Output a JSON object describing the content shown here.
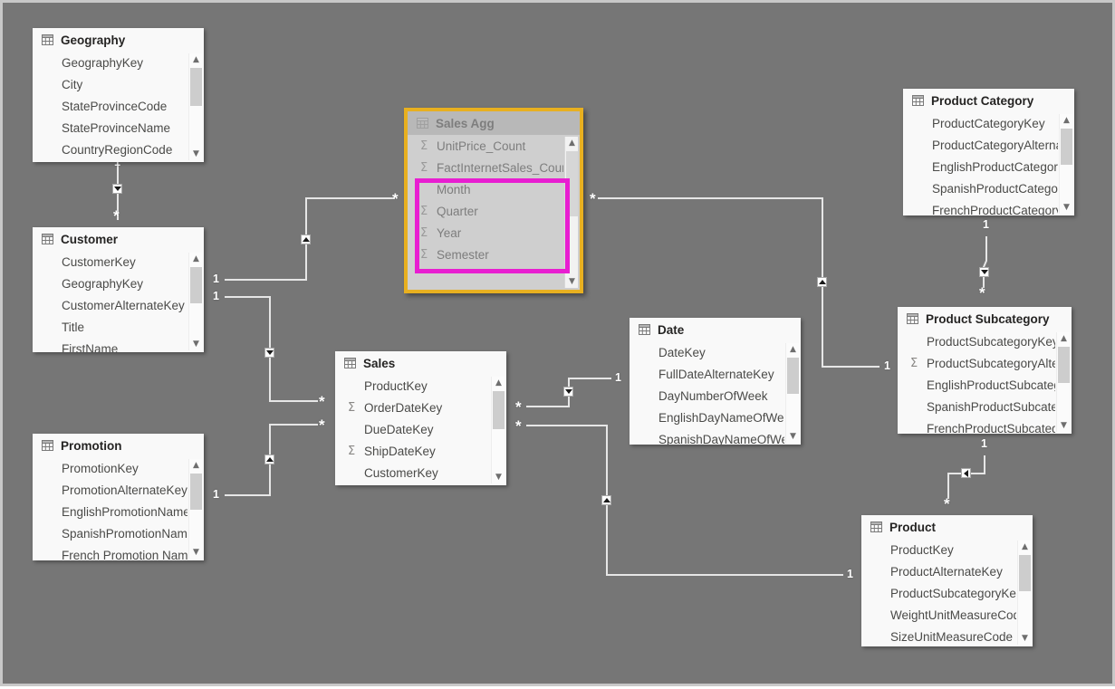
{
  "canvas": {
    "background_color": "#767676",
    "border_color": "#c8c8c8"
  },
  "highlight": {
    "selected_table_border_color": "#e8b020",
    "emphasis_box_color": "#e81ed1",
    "emphasis_fields": [
      "Month",
      "Quarter",
      "Year",
      "Semester"
    ]
  },
  "tables": [
    {
      "id": "geography",
      "name": "Geography",
      "icon": "table-grid-icon",
      "fields": [
        {
          "name": "GeographyKey",
          "aggregate": false
        },
        {
          "name": "City",
          "aggregate": false
        },
        {
          "name": "StateProvinceCode",
          "aggregate": false
        },
        {
          "name": "StateProvinceName",
          "aggregate": false
        },
        {
          "name": "CountryRegionCode",
          "aggregate": false
        }
      ]
    },
    {
      "id": "customer",
      "name": "Customer",
      "icon": "table-grid-icon",
      "fields": [
        {
          "name": "CustomerKey",
          "aggregate": false
        },
        {
          "name": "GeographyKey",
          "aggregate": false
        },
        {
          "name": "CustomerAlternateKey",
          "aggregate": false
        },
        {
          "name": "Title",
          "aggregate": false
        },
        {
          "name": "FirstName",
          "aggregate": false
        }
      ]
    },
    {
      "id": "promotion",
      "name": "Promotion",
      "icon": "table-grid-icon",
      "fields": [
        {
          "name": "PromotionKey",
          "aggregate": false
        },
        {
          "name": "PromotionAlternateKey",
          "aggregate": false
        },
        {
          "name": "EnglishPromotionName",
          "aggregate": false
        },
        {
          "name": "SpanishPromotionName",
          "aggregate": false
        },
        {
          "name": "French Promotion Name",
          "aggregate": false
        }
      ]
    },
    {
      "id": "salesagg",
      "name": "Sales Agg",
      "icon": "table-grid-icon",
      "selected": true,
      "fields": [
        {
          "name": "UnitPrice_Count",
          "aggregate": true
        },
        {
          "name": "FactInternetSales_Count",
          "aggregate": true
        },
        {
          "name": "Month",
          "aggregate": false
        },
        {
          "name": "Quarter",
          "aggregate": true
        },
        {
          "name": "Year",
          "aggregate": true
        },
        {
          "name": "Semester",
          "aggregate": true
        }
      ]
    },
    {
      "id": "sales",
      "name": "Sales",
      "icon": "table-grid-icon",
      "fields": [
        {
          "name": "ProductKey",
          "aggregate": false
        },
        {
          "name": "OrderDateKey",
          "aggregate": true
        },
        {
          "name": "DueDateKey",
          "aggregate": false
        },
        {
          "name": "ShipDateKey",
          "aggregate": true
        },
        {
          "name": "CustomerKey",
          "aggregate": false
        }
      ]
    },
    {
      "id": "date",
      "name": "Date",
      "icon": "table-grid-icon",
      "fields": [
        {
          "name": "DateKey",
          "aggregate": false
        },
        {
          "name": "FullDateAlternateKey",
          "aggregate": false
        },
        {
          "name": "DayNumberOfWeek",
          "aggregate": false
        },
        {
          "name": "EnglishDayNameOfWeek",
          "aggregate": false
        },
        {
          "name": "SpanishDayNameOfWeek",
          "aggregate": false
        }
      ]
    },
    {
      "id": "productcategory",
      "name": "Product Category",
      "icon": "table-grid-icon",
      "fields": [
        {
          "name": "ProductCategoryKey",
          "aggregate": false
        },
        {
          "name": "ProductCategoryAlternateKey",
          "aggregate": false
        },
        {
          "name": "EnglishProductCategoryName",
          "aggregate": false
        },
        {
          "name": "SpanishProductCategoryName",
          "aggregate": false
        },
        {
          "name": "FrenchProductCategoryName",
          "aggregate": false
        }
      ]
    },
    {
      "id": "productsubcategory",
      "name": "Product Subcategory",
      "icon": "table-grid-icon",
      "fields": [
        {
          "name": "ProductSubcategoryKey",
          "aggregate": false
        },
        {
          "name": "ProductSubcategoryAlternateKey",
          "aggregate": true
        },
        {
          "name": "EnglishProductSubcategoryName",
          "aggregate": false
        },
        {
          "name": "SpanishProductSubcategoryName",
          "aggregate": false
        },
        {
          "name": "FrenchProductSubcategoryName",
          "aggregate": false
        }
      ]
    },
    {
      "id": "product",
      "name": "Product",
      "icon": "table-grid-icon",
      "fields": [
        {
          "name": "ProductKey",
          "aggregate": false
        },
        {
          "name": "ProductAlternateKey",
          "aggregate": false
        },
        {
          "name": "ProductSubcategoryKey",
          "aggregate": false
        },
        {
          "name": "WeightUnitMeasureCode",
          "aggregate": false
        },
        {
          "name": "SizeUnitMeasureCode",
          "aggregate": false
        }
      ]
    }
  ],
  "relationship_markers": {
    "one": "1",
    "many": "*"
  },
  "relationships": [
    {
      "from": "Geography",
      "from_cardinality": "1",
      "to": "Customer",
      "to_cardinality": "*",
      "cross_filter": "single-down"
    },
    {
      "from": "Customer",
      "from_cardinality": "1",
      "to": "Sales Agg",
      "to_cardinality": "*",
      "cross_filter": "single-up"
    },
    {
      "from": "Customer",
      "from_cardinality": "1",
      "to": "Sales",
      "to_cardinality": "*",
      "cross_filter": "single-down"
    },
    {
      "from": "Promotion",
      "from_cardinality": "1",
      "to": "Sales",
      "to_cardinality": "*",
      "cross_filter": "single-up"
    },
    {
      "from": "Sales Agg",
      "from_cardinality": "*",
      "to": "Product Subcategory",
      "to_cardinality": "1",
      "cross_filter": "single-up"
    },
    {
      "from": "Sales",
      "from_cardinality": "*",
      "to": "Date",
      "to_cardinality": "1",
      "cross_filter": "single-down"
    },
    {
      "from": "Sales",
      "from_cardinality": "*",
      "to": "Product",
      "to_cardinality": "1",
      "cross_filter": "single-up"
    },
    {
      "from": "Product Category",
      "from_cardinality": "1",
      "to": "Product Subcategory",
      "to_cardinality": "*",
      "cross_filter": "single-down"
    },
    {
      "from": "Product Subcategory",
      "from_cardinality": "1",
      "to": "Product",
      "to_cardinality": "*",
      "cross_filter": "single-left"
    }
  ]
}
